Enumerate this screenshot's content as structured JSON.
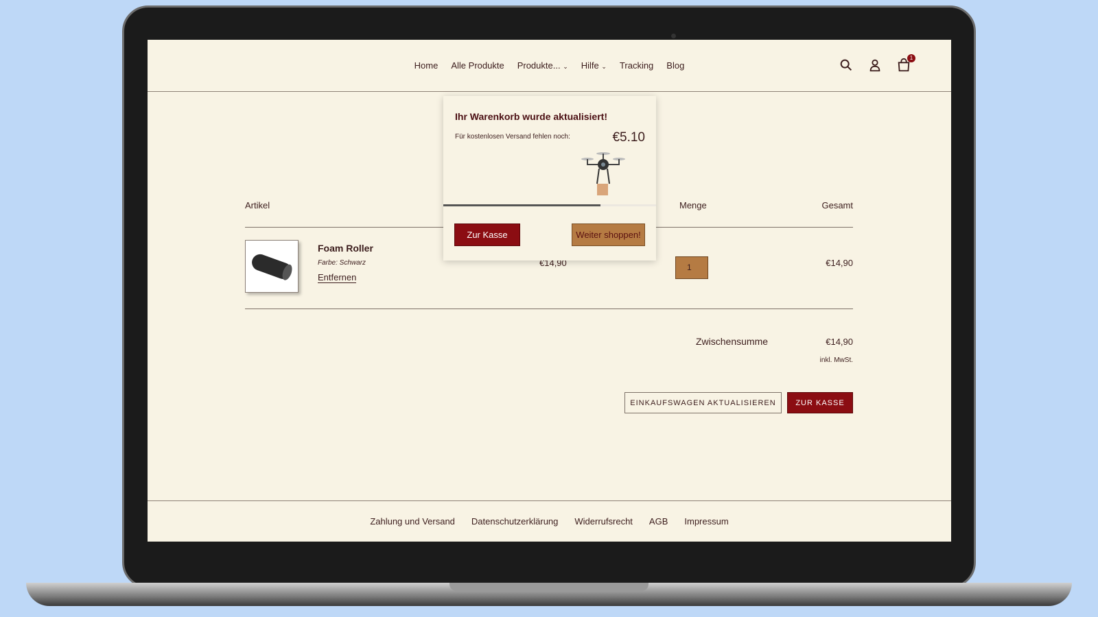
{
  "nav": {
    "items": [
      "Home",
      "Alle Produkte",
      "Produkte...",
      "Hilfe",
      "Tracking",
      "Blog"
    ],
    "cart_count": "1"
  },
  "cart": {
    "headers": {
      "item": "Artikel",
      "qty": "Menge",
      "total": "Gesamt"
    },
    "item": {
      "name": "Foam Roller",
      "variant": "Farbe: Schwarz",
      "remove": "Entfernen",
      "price": "€14,90",
      "quantity": "1",
      "total": "€14,90"
    },
    "subtotal_label": "Zwischensumme",
    "subtotal": "€14,90",
    "tax_note": "inkl. MwSt.",
    "update_button": "EINKAUFSWAGEN AKTUALISIEREN",
    "checkout_button": "ZUR KASSE"
  },
  "popup": {
    "title": "Ihr Warenkorb wurde aktualisiert!",
    "shipping_text": "Für kostenlosen Versand fehlen noch:",
    "remaining": "€5.10",
    "progress": 0.74,
    "checkout": "Zur Kasse",
    "continue": "Weiter shoppen!"
  },
  "footer": {
    "links": [
      "Zahlung und Versand",
      "Datenschutzerklärung",
      "Widerrufsrecht",
      "AGB",
      "Impressum"
    ]
  },
  "colors": {
    "accent": "#8b0d12",
    "secondary": "#b57b43",
    "background": "#f8f3e4"
  }
}
